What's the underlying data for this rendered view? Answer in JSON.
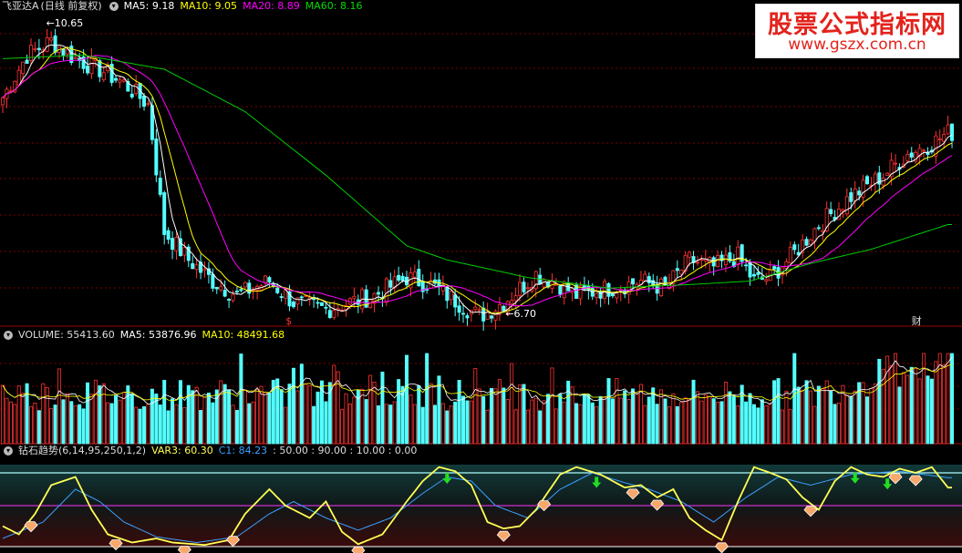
{
  "colors": {
    "up": "#ff3232",
    "down": "#54ffff",
    "ma5": "#ffffff",
    "ma10": "#ffff00",
    "ma20": "#ff00ff",
    "ma60": "#00cc00",
    "var3": "#ffff55",
    "c1": "#3aa0ff",
    "grid": "#7a0000",
    "panel_border": "#a00000"
  },
  "price_panel": {
    "stock_name": "飞亚达A",
    "period": "(日线 前复权)",
    "ma5": "MA5: 9.18",
    "ma10": "MA10: 9.05",
    "ma20": "MA20: 8.89",
    "ma60": "MA60: 8.16",
    "high_label": "10.65",
    "low_label": "6.70",
    "marker_dollar": "$",
    "marker_cai": "财"
  },
  "volume_panel": {
    "volume": "VOLUME: 55413.60",
    "ma5": "MA5: 53876.96",
    "ma10": "MA10: 48491.68"
  },
  "indicator_panel": {
    "name": "钻石趋势(6,14,95,250,1,2)",
    "var3": "VAR3: 60.30",
    "c1": "C1: 84.23",
    "levels": ": 50.00 : 90.00 : 10.00 : 0.00"
  },
  "watermark": {
    "line1": "股票公式指标网",
    "line2": "www.gszx.com.cn"
  },
  "chart_data": {
    "type": "candlestick",
    "ylim": [
      6.5,
      10.9
    ],
    "price_anchors": [
      [
        0,
        9.7
      ],
      [
        6,
        10.3
      ],
      [
        12,
        10.5
      ],
      [
        18,
        10.25
      ],
      [
        24,
        10.1
      ],
      [
        30,
        9.9
      ],
      [
        36,
        9.6
      ],
      [
        40,
        7.8
      ],
      [
        46,
        7.4
      ],
      [
        52,
        7.1
      ],
      [
        58,
        6.9
      ],
      [
        66,
        7.1
      ],
      [
        72,
        6.8
      ],
      [
        80,
        6.7
      ],
      [
        86,
        6.8
      ],
      [
        92,
        6.9
      ],
      [
        100,
        7.15
      ],
      [
        106,
        7.05
      ],
      [
        114,
        6.75
      ],
      [
        118,
        6.6
      ],
      [
        124,
        6.8
      ],
      [
        132,
        7.2
      ],
      [
        138,
        7.05
      ],
      [
        142,
        6.9
      ],
      [
        150,
        7.0
      ],
      [
        158,
        7.1
      ],
      [
        164,
        7.0
      ],
      [
        170,
        7.4
      ],
      [
        176,
        7.3
      ],
      [
        182,
        7.45
      ],
      [
        186,
        7.1
      ],
      [
        190,
        7.15
      ],
      [
        196,
        7.5
      ],
      [
        202,
        7.9
      ],
      [
        210,
        8.3
      ],
      [
        218,
        8.6
      ],
      [
        224,
        8.9
      ],
      [
        230,
        9.05
      ],
      [
        234,
        9.2
      ]
    ],
    "ma60_anchors": [
      [
        0,
        10.25
      ],
      [
        20,
        10.3
      ],
      [
        40,
        10.1
      ],
      [
        60,
        9.5
      ],
      [
        80,
        8.6
      ],
      [
        100,
        7.6
      ],
      [
        110,
        7.4
      ],
      [
        130,
        7.15
      ],
      [
        150,
        7.0
      ],
      [
        170,
        7.05
      ],
      [
        185,
        7.1
      ],
      [
        200,
        7.35
      ],
      [
        215,
        7.55
      ],
      [
        234,
        7.9
      ]
    ],
    "indicator_var3_anchors": [
      [
        0,
        25
      ],
      [
        4,
        15
      ],
      [
        8,
        40
      ],
      [
        12,
        75
      ],
      [
        18,
        85
      ],
      [
        22,
        45
      ],
      [
        26,
        15
      ],
      [
        32,
        5
      ],
      [
        38,
        10
      ],
      [
        42,
        5
      ],
      [
        50,
        2
      ],
      [
        56,
        8
      ],
      [
        60,
        40
      ],
      [
        66,
        70
      ],
      [
        70,
        50
      ],
      [
        76,
        35
      ],
      [
        80,
        55
      ],
      [
        84,
        18
      ],
      [
        88,
        3
      ],
      [
        94,
        15
      ],
      [
        100,
        55
      ],
      [
        104,
        80
      ],
      [
        108,
        97
      ],
      [
        112,
        92
      ],
      [
        116,
        75
      ],
      [
        120,
        30
      ],
      [
        124,
        22
      ],
      [
        128,
        25
      ],
      [
        132,
        45
      ],
      [
        138,
        88
      ],
      [
        142,
        97
      ],
      [
        148,
        88
      ],
      [
        154,
        72
      ],
      [
        158,
        75
      ],
      [
        162,
        60
      ],
      [
        166,
        70
      ],
      [
        170,
        35
      ],
      [
        174,
        20
      ],
      [
        178,
        8
      ],
      [
        182,
        55
      ],
      [
        186,
        97
      ],
      [
        190,
        90
      ],
      [
        194,
        82
      ],
      [
        198,
        60
      ],
      [
        202,
        45
      ],
      [
        206,
        80
      ],
      [
        210,
        97
      ],
      [
        214,
        88
      ],
      [
        218,
        85
      ],
      [
        222,
        95
      ],
      [
        226,
        90
      ],
      [
        230,
        97
      ],
      [
        234,
        72
      ]
    ],
    "indicator_c1_anchors": [
      [
        0,
        10
      ],
      [
        10,
        30
      ],
      [
        18,
        70
      ],
      [
        24,
        55
      ],
      [
        30,
        30
      ],
      [
        38,
        12
      ],
      [
        48,
        5
      ],
      [
        58,
        12
      ],
      [
        66,
        40
      ],
      [
        72,
        55
      ],
      [
        80,
        35
      ],
      [
        88,
        20
      ],
      [
        96,
        35
      ],
      [
        104,
        65
      ],
      [
        110,
        85
      ],
      [
        116,
        80
      ],
      [
        122,
        50
      ],
      [
        130,
        35
      ],
      [
        138,
        70
      ],
      [
        146,
        90
      ],
      [
        154,
        78
      ],
      [
        160,
        70
      ],
      [
        168,
        55
      ],
      [
        176,
        30
      ],
      [
        184,
        60
      ],
      [
        192,
        85
      ],
      [
        200,
        75
      ],
      [
        210,
        88
      ],
      [
        222,
        92
      ],
      [
        234,
        84
      ]
    ],
    "down_arrows": [
      110,
      147,
      211,
      219
    ],
    "diamonds": [
      7,
      28,
      45,
      57,
      88,
      124,
      134,
      156,
      162,
      178,
      200,
      221,
      226
    ]
  }
}
